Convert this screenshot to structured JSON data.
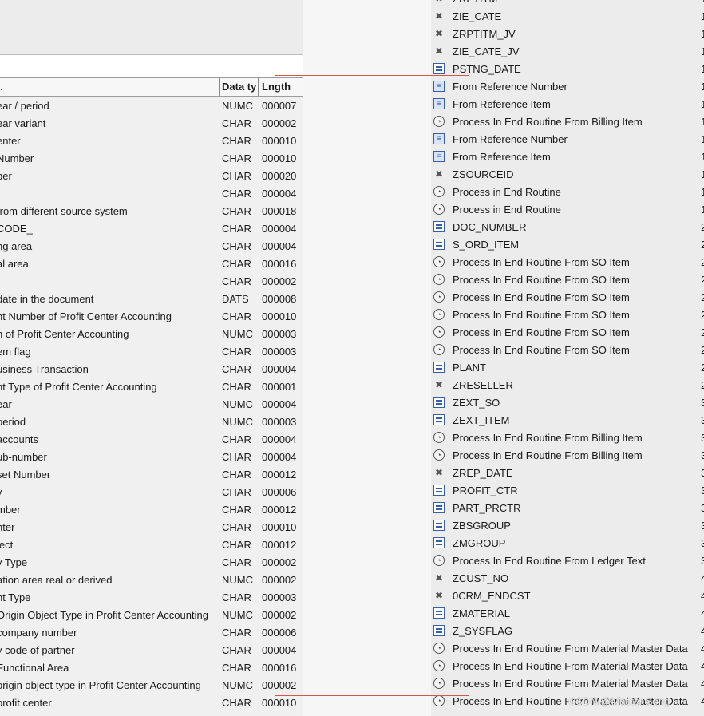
{
  "left_table": {
    "headers": {
      "description": "t.",
      "data_type": "Data ty",
      "length": "Lngth"
    },
    "rows": [
      {
        "desc": "ear / period",
        "type": "NUMC",
        "len": "000007"
      },
      {
        "desc": "ear variant",
        "type": "CHAR",
        "len": "000002"
      },
      {
        "desc": "enter",
        "type": "CHAR",
        "len": "000010"
      },
      {
        "desc": "Number",
        "type": "CHAR",
        "len": "000010"
      },
      {
        "desc": "ber",
        "type": "CHAR",
        "len": "000020"
      },
      {
        "desc": "",
        "type": "CHAR",
        "len": "000004"
      },
      {
        "desc": "from different source system",
        "type": "CHAR",
        "len": "000018"
      },
      {
        "desc": "_CODE",
        "type": "CHAR",
        "len": "000004"
      },
      {
        "desc": "ng area",
        "type": "CHAR",
        "len": "000004"
      },
      {
        "desc": "al area",
        "type": "CHAR",
        "len": "000016"
      },
      {
        "desc": "",
        "type": "CHAR",
        "len": "000002"
      },
      {
        "desc": "date in the document",
        "type": "DATS",
        "len": "000008"
      },
      {
        "desc": "nt Number of Profit Center Accounting",
        "type": "CHAR",
        "len": "000010"
      },
      {
        "desc": "n of Profit Center Accounting",
        "type": "NUMC",
        "len": "000003"
      },
      {
        "desc": "em flag",
        "type": "CHAR",
        "len": "000003"
      },
      {
        "desc": "usiness Transaction",
        "type": "CHAR",
        "len": "000004"
      },
      {
        "desc": "nt Type of Profit Center Accounting",
        "type": "CHAR",
        "len": "000001"
      },
      {
        "desc": "ear",
        "type": "NUMC",
        "len": "000004"
      },
      {
        "desc": "period",
        "type": "NUMC",
        "len": "000003"
      },
      {
        "desc": "accounts",
        "type": "CHAR",
        "len": "000004"
      },
      {
        "desc": "ub-number",
        "type": "CHAR",
        "len": "000004"
      },
      {
        "desc": "set Number",
        "type": "CHAR",
        "len": "000012"
      },
      {
        "desc": "y",
        "type": "CHAR",
        "len": "000006"
      },
      {
        "desc": "mber",
        "type": "CHAR",
        "len": "000012"
      },
      {
        "desc": "nter",
        "type": "CHAR",
        "len": "000010"
      },
      {
        "desc": "ject",
        "type": "CHAR",
        "len": "000012"
      },
      {
        "desc": "y Type",
        "type": "CHAR",
        "len": "000002"
      },
      {
        "desc": "ation area real or derived",
        "type": "NUMC",
        "len": "000002"
      },
      {
        "desc": "nt Type",
        "type": "CHAR",
        "len": "000003"
      },
      {
        "desc": "Origin Object Type in Profit Center Accounting",
        "type": "NUMC",
        "len": "000002"
      },
      {
        "desc": "company number",
        "type": "CHAR",
        "len": "000006"
      },
      {
        "desc": "y code of partner",
        "type": "CHAR",
        "len": "000004"
      },
      {
        "desc": "Functional Area",
        "type": "CHAR",
        "len": "000016"
      },
      {
        "desc": "origin object type in Profit Center Accounting",
        "type": "NUMC",
        "len": "000002"
      },
      {
        "desc": "profit center",
        "type": "CHAR",
        "len": "000010"
      }
    ]
  },
  "right_list": {
    "rows": [
      {
        "icon": "none-icon",
        "label": "ZRPTITM",
        "num": "1"
      },
      {
        "icon": "none-icon",
        "label": "ZIE_CATE",
        "num": "1"
      },
      {
        "icon": "none-icon",
        "label": "ZRPTITM_JV",
        "num": "1"
      },
      {
        "icon": "none-icon",
        "label": "ZIE_CATE_JV",
        "num": "1"
      },
      {
        "icon": "direct-assignment-icon",
        "label": "PSTNG_DATE",
        "num": "1"
      },
      {
        "icon": "formula-icon",
        "label": "From Reference Number",
        "num": "1"
      },
      {
        "icon": "formula-icon",
        "label": "From Reference Item",
        "num": "1"
      },
      {
        "icon": "routine-icon",
        "label": "Process In End Routine From Billing Item",
        "num": "1"
      },
      {
        "icon": "formula-icon",
        "label": "From Reference Number",
        "num": "1"
      },
      {
        "icon": "formula-icon",
        "label": "From Reference Item",
        "num": "1"
      },
      {
        "icon": "none-icon",
        "label": "ZSOURCEID",
        "num": "1"
      },
      {
        "icon": "routine-icon",
        "label": "Process in End Routine",
        "num": "1"
      },
      {
        "icon": "routine-icon",
        "label": "Process in End Routine",
        "num": "1"
      },
      {
        "icon": "direct-assignment-icon",
        "label": "DOC_NUMBER",
        "num": "2"
      },
      {
        "icon": "direct-assignment-icon",
        "label": "S_ORD_ITEM",
        "num": "2"
      },
      {
        "icon": "routine-icon",
        "label": "Process In End Routine From SO Item",
        "num": "2"
      },
      {
        "icon": "routine-icon",
        "label": "Process In End Routine From SO Item",
        "num": "2"
      },
      {
        "icon": "routine-icon",
        "label": "Process In End Routine From SO Item",
        "num": "2"
      },
      {
        "icon": "routine-icon",
        "label": "Process In End Routine From SO Item",
        "num": "2"
      },
      {
        "icon": "routine-icon",
        "label": "Process In End Routine From SO Item",
        "num": "2"
      },
      {
        "icon": "routine-icon",
        "label": "Process In End Routine From SO Item",
        "num": "2"
      },
      {
        "icon": "direct-assignment-icon",
        "label": "PLANT",
        "num": "2"
      },
      {
        "icon": "none-icon",
        "label": "ZRESELLER",
        "num": "2"
      },
      {
        "icon": "direct-assignment-icon",
        "label": "ZEXT_SO",
        "num": "3"
      },
      {
        "icon": "direct-assignment-icon",
        "label": "ZEXT_ITEM",
        "num": "3"
      },
      {
        "icon": "routine-icon",
        "label": "Process In End Routine From Billing Item",
        "num": "3"
      },
      {
        "icon": "routine-icon",
        "label": "Process In End Routine From Billing Item",
        "num": "3"
      },
      {
        "icon": "none-icon",
        "label": "ZREP_DATE",
        "num": "3"
      },
      {
        "icon": "direct-assignment-icon",
        "label": "PROFIT_CTR",
        "num": "3"
      },
      {
        "icon": "direct-assignment-icon",
        "label": "PART_PRCTR",
        "num": "3"
      },
      {
        "icon": "direct-assignment-icon",
        "label": "ZBSGROUP",
        "num": "3"
      },
      {
        "icon": "direct-assignment-icon",
        "label": "ZMGROUP",
        "num": "3"
      },
      {
        "icon": "routine-icon",
        "label": "Process In End Routine From Ledger Text",
        "num": "3"
      },
      {
        "icon": "none-icon",
        "label": "ZCUST_NO",
        "num": "4"
      },
      {
        "icon": "none-icon",
        "label": "0CRM_ENDCST",
        "num": "4"
      },
      {
        "icon": "direct-assignment-icon",
        "label": "ZMATERIAL",
        "num": "4"
      },
      {
        "icon": "direct-assignment-icon",
        "label": "Z_SYSFLAG",
        "num": "4"
      },
      {
        "icon": "routine-icon",
        "label": "Process In End Routine From Material Master Data",
        "num": "4"
      },
      {
        "icon": "routine-icon",
        "label": "Process In End Routine From Material Master Data",
        "num": "4"
      },
      {
        "icon": "routine-icon",
        "label": "Process In End Routine From Material Master Data",
        "num": "4"
      },
      {
        "icon": "routine-icon",
        "label": "Process In End Routine From Material Master Data",
        "num": "4"
      }
    ]
  },
  "watermark": "CSDN @Master Song"
}
